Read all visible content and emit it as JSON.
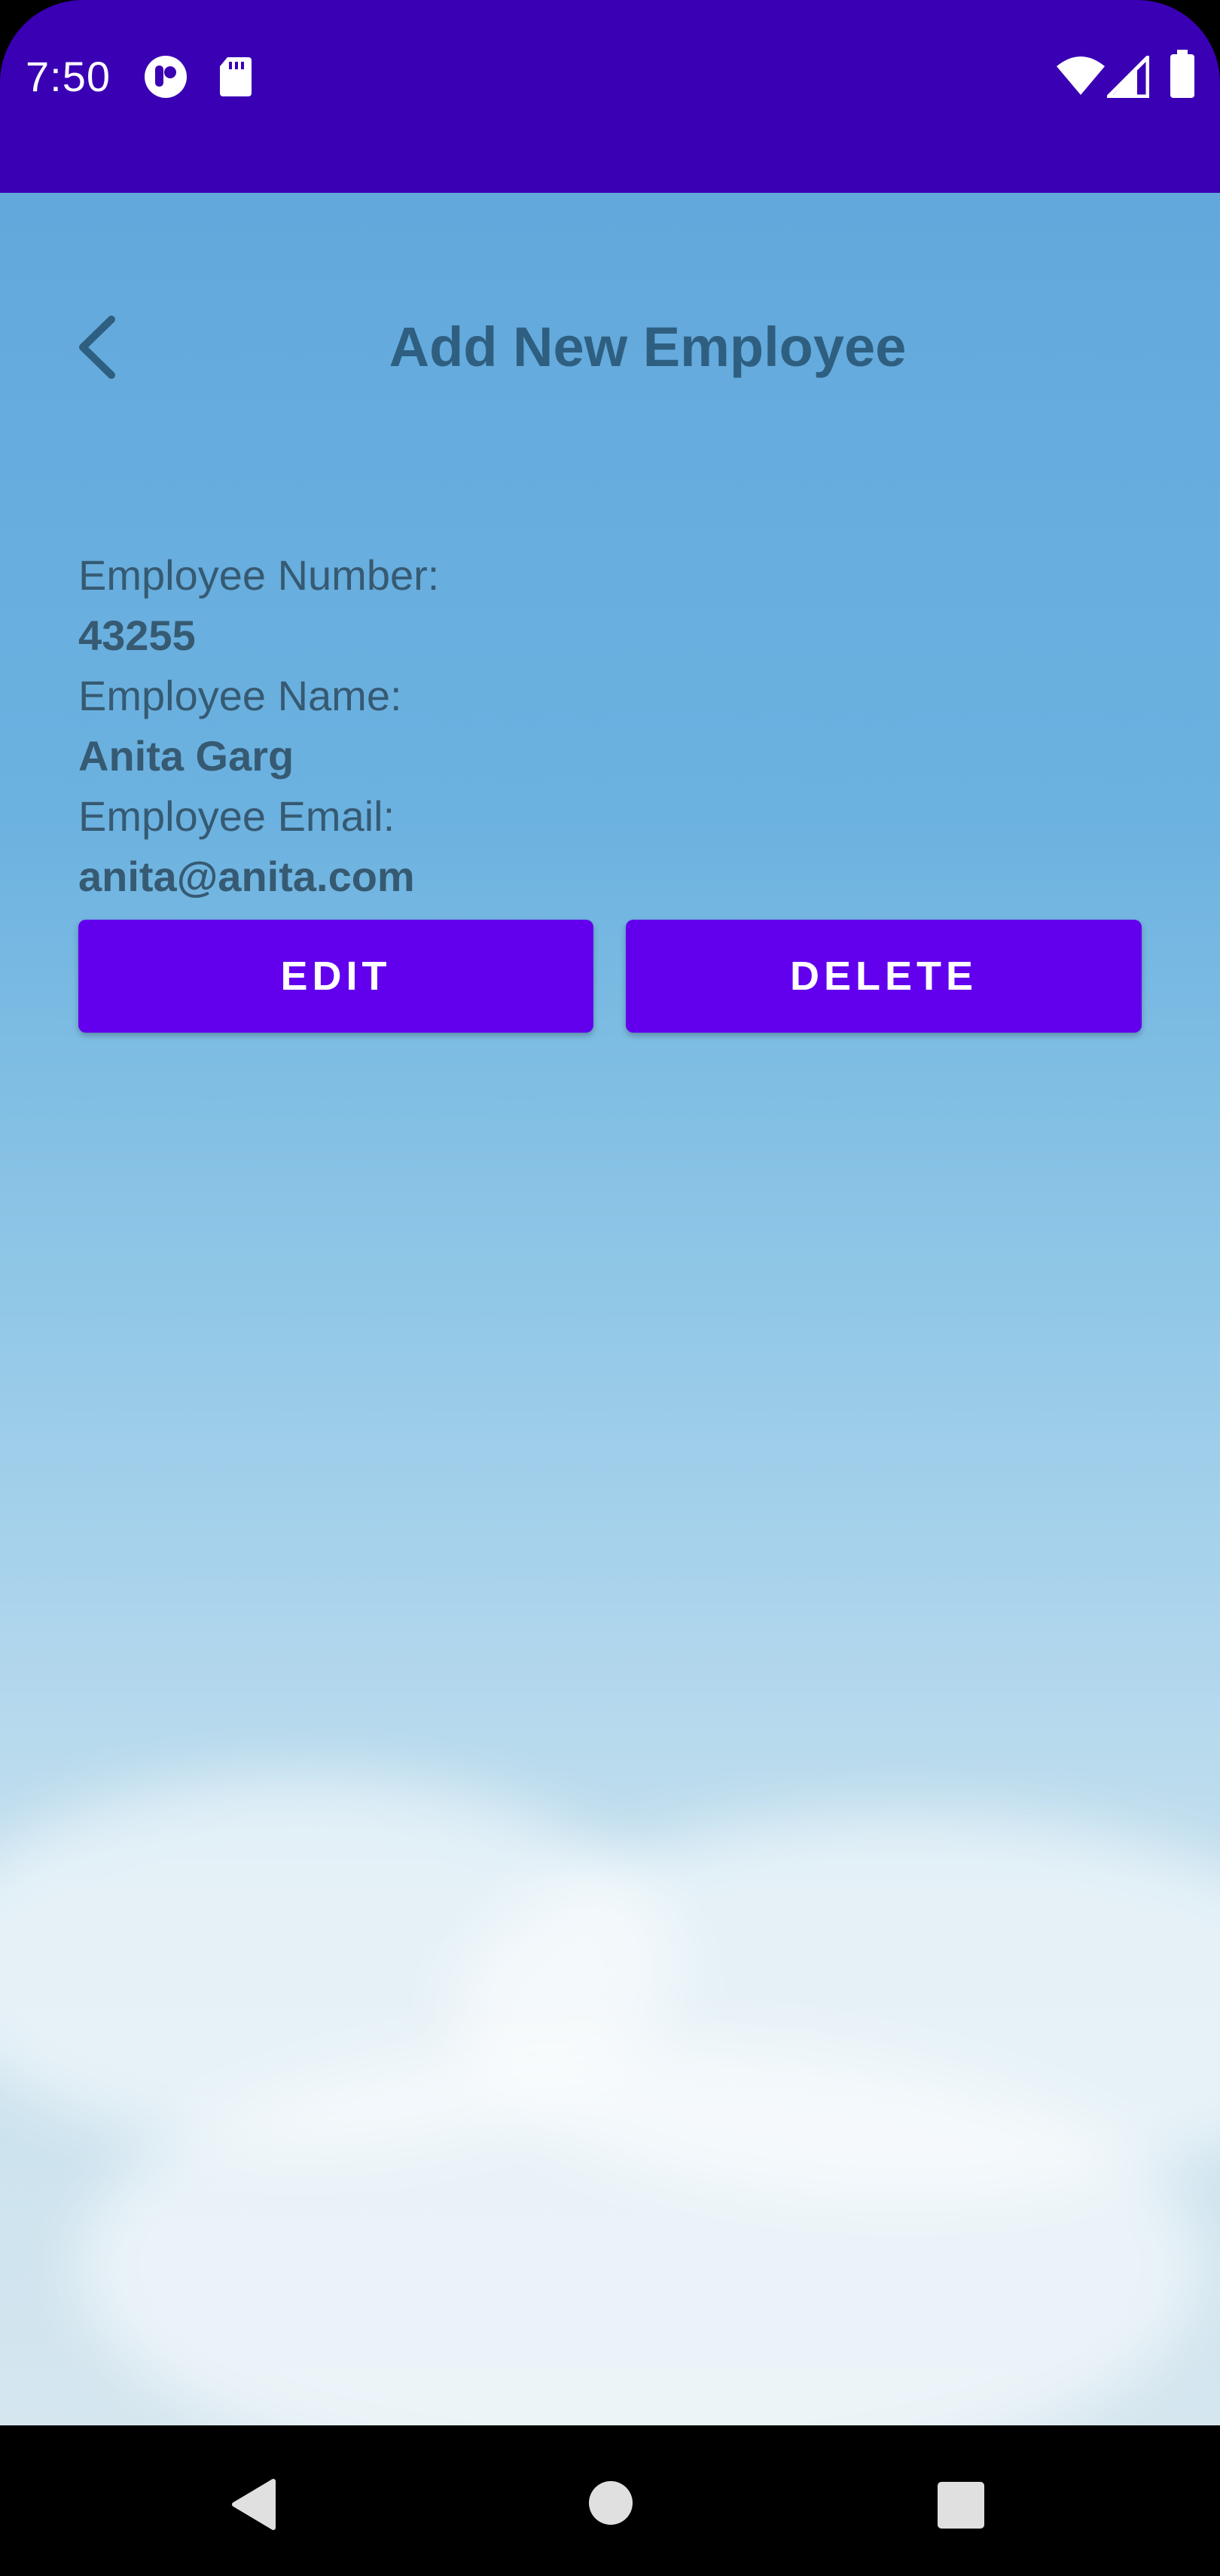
{
  "status_bar": {
    "time": "7:50",
    "background_color": "#3a00b4",
    "left_icons": [
      "notification-app-icon",
      "sd-card-icon"
    ],
    "right_icons": [
      "wifi-icon",
      "cellular-signal-icon",
      "battery-icon"
    ]
  },
  "header": {
    "back_icon": "chevron-left-icon",
    "title": "Add New Employee"
  },
  "employee": {
    "number_label": "Employee Number:",
    "number_value": "43255",
    "name_label": "Employee Name:",
    "name_value": "Anita Garg",
    "email_label": "Employee Email:",
    "email_value": "anita@anita.com"
  },
  "actions": {
    "edit_label": "EDIT",
    "delete_label": "DELETE",
    "button_color": "#6200ee"
  },
  "navigation_bar": {
    "icons": [
      "back-triangle-icon",
      "home-circle-icon",
      "recents-square-icon"
    ]
  },
  "colors": {
    "title_text": "#2f5f80",
    "body_text": "#365a72"
  }
}
